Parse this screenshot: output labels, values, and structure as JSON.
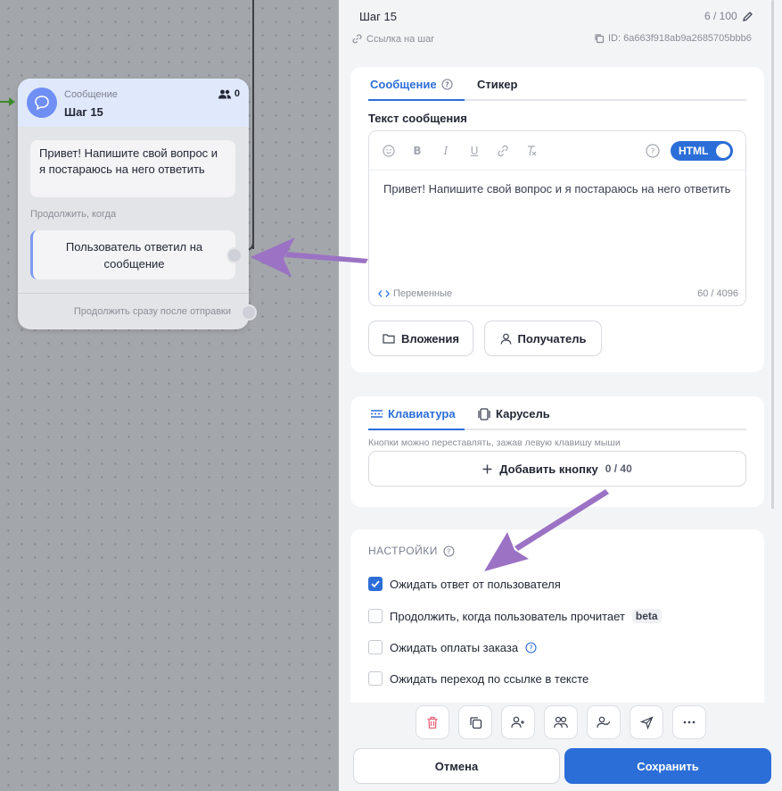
{
  "node": {
    "type_label": "Сообщение",
    "title": "Шаг 15",
    "users_count": "0",
    "message": "Привет! Напишите свой вопрос и я постараюсь на него ответить",
    "continue_label": "Продолжить, когда",
    "condition": "Пользователь ответил на сообщение",
    "after_send": "Продолжить сразу после отправки"
  },
  "panel": {
    "step_name": "Шаг 15",
    "name_count": "6 / 100",
    "step_link": "Ссылка на шаг",
    "step_id": "ID: 6a663f918ab9a2685705bbb6",
    "message_tabs": [
      "Сообщение",
      "Стикер"
    ],
    "text_label": "Текст сообщения",
    "html_toggle": "HTML",
    "editor_text": "Привет! Напишите свой вопрос и я постараюсь на него ответить",
    "variables_link": "Переменные",
    "char_count": "60 / 4096",
    "attachments_button": "Вложения",
    "recipient_button": "Получатель",
    "keyboard_tabs": [
      "Клавиатура",
      "Карусель"
    ],
    "buttons_hint": "Кнопки можно переставлять, зажав левую клавишу мыши",
    "add_button_label": "Добавить кнопку",
    "add_button_count": "0 / 40",
    "settings_title": "НАСТРОЙКИ",
    "settings": [
      {
        "label": "Ожидать ответ от пользователя",
        "checked": true
      },
      {
        "label": "Продолжить, когда пользователь прочитает",
        "badge": "beta",
        "checked": false
      },
      {
        "label": "Ожидать оплаты заказа",
        "checked": false
      },
      {
        "label": "Ожидать переход по ссылке в тексте",
        "checked": false
      }
    ],
    "cancel_button": "Отмена",
    "save_button": "Сохранить"
  },
  "colors": {
    "accent": "#2c6ed8",
    "canvas": "#a3a6ab",
    "annotation_arrow": "#9b72c4",
    "delete_icon": "#e8647a"
  }
}
